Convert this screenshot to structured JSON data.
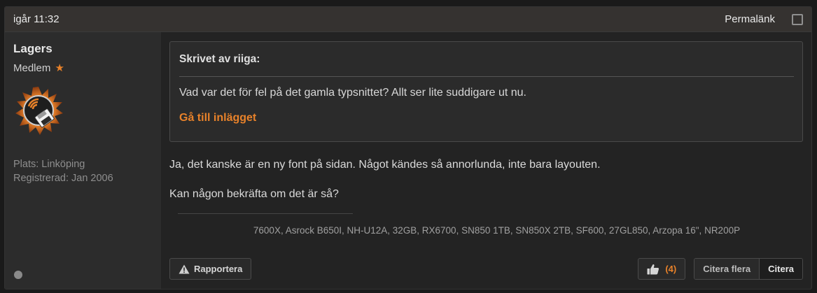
{
  "post": {
    "date": "igår 11:32",
    "permalink_label": "Permalänk"
  },
  "author": {
    "name": "Lagers",
    "role": "Medlem",
    "role_star": "★",
    "location": "Plats: Linköping",
    "registered": "Registrerad: Jan 2006",
    "avatar_icon": "floppy-disk-avatar-icon"
  },
  "quote": {
    "title": "Skrivet av riiga:",
    "text": "Vad var det för fel på det gamla typsnittet? Allt ser lite suddigare ut nu.",
    "link_label": "Gå till inlägget"
  },
  "message": {
    "paragraph_1": "Ja, det kanske är en ny font på sidan. Något kändes så annorlunda, inte bara layouten.",
    "paragraph_2": "Kan någon bekräfta om det är så?"
  },
  "signature": "7600X, Asrock B650I, NH-U12A, 32GB, RX6700, SN850 1TB, SN850X 2TB, SF600, 27GL850, Arzopa 16\", NR200P",
  "actions": {
    "report_label": "Rapportera",
    "like_count": "(4)",
    "quote_multiple_label": "Citera flera",
    "quote_label": "Citera"
  },
  "colors": {
    "accent": "#e8822a",
    "background": "#1a1a1a",
    "header": "#353230"
  }
}
